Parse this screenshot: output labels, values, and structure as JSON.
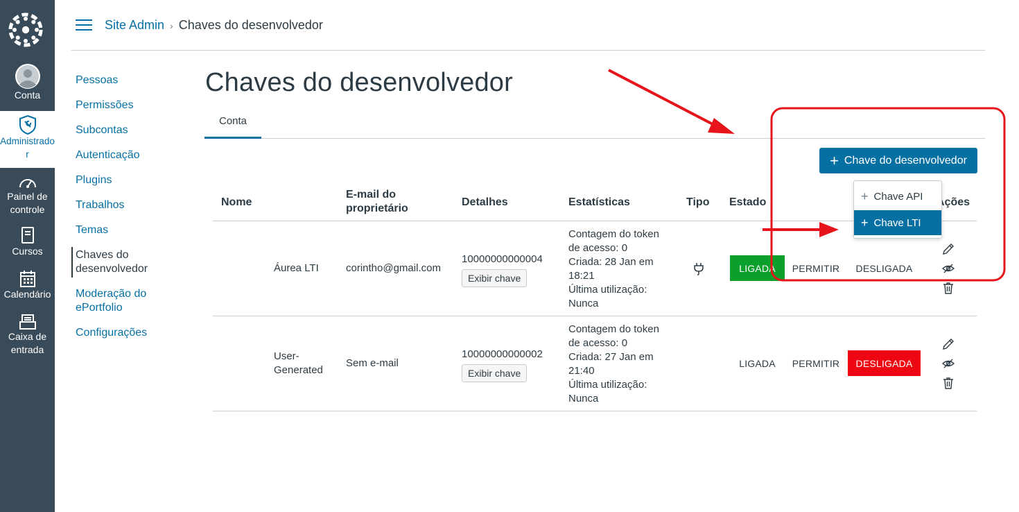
{
  "global_nav": {
    "items": [
      {
        "label": "Conta",
        "icon": "user-avatar-icon"
      },
      {
        "label": "Administrador",
        "icon": "admin-shield-icon"
      },
      {
        "label_lines": [
          "Painel de",
          "controle"
        ],
        "icon": "dashboard-icon"
      },
      {
        "label": "Cursos",
        "icon": "courses-icon"
      },
      {
        "label": "Calendário",
        "icon": "calendar-icon"
      },
      {
        "label_lines": [
          "Caixa de",
          "entrada"
        ],
        "icon": "inbox-icon"
      }
    ],
    "admin_label_lines": [
      "Administrado",
      "r"
    ]
  },
  "header": {
    "breadcrumb_root": "Site Admin",
    "breadcrumb_current": "Chaves do desenvolvedor"
  },
  "subnav": {
    "items": [
      "Pessoas",
      "Permissões",
      "Subcontas",
      "Autenticação",
      "Plugins",
      "Trabalhos",
      "Temas"
    ],
    "active_lines": [
      "Chaves do",
      "desenvolvedor"
    ],
    "after_lines": [
      "Moderação do",
      "ePortfolio"
    ],
    "last": "Configurações"
  },
  "main": {
    "title": "Chaves do desenvolvedor",
    "tab": "Conta",
    "add_button": "Chave do desenvolvedor",
    "dropdown": {
      "items": [
        "Chave API",
        "Chave LTI"
      ],
      "highlighted": "Chave LTI"
    }
  },
  "table": {
    "headers": {
      "name": "Nome",
      "owner_lines": [
        "E-mail do",
        "proprietário"
      ],
      "details": "Detalhes",
      "stats": "Estatísticas",
      "type": "Tipo",
      "state": "Estado",
      "actions": "Ações"
    },
    "rows": [
      {
        "name_lines": [
          "Áurea LTI"
        ],
        "email": "corintho@gmail.com",
        "id": "10000000000004",
        "show_key": "Exibir chave",
        "stats_lines": [
          "Contagem do token",
          "de acesso: 0",
          "Criada: 28 Jan em",
          "18:21",
          "Última utilização:",
          "Nunca"
        ],
        "type_icon": "plug-icon",
        "states": [
          "LIGADA",
          "PERMITIR",
          "DESLIGADA"
        ],
        "active_state": "LIGADA"
      },
      {
        "name_lines": [
          "User-",
          "Generated"
        ],
        "email": "Sem e-mail",
        "id": "10000000000002",
        "show_key": "Exibir chave",
        "stats_lines": [
          "Contagem do token",
          "de acesso: 0",
          "Criada: 27 Jan em",
          "21:40",
          "Última utilização:",
          "Nunca"
        ],
        "type_icon": "",
        "states": [
          "LIGADA",
          "PERMITIR",
          "DESLIGADA"
        ],
        "active_state": "DESLIGADA"
      }
    ]
  },
  "colors": {
    "brand": "#0770a3",
    "nav_bg": "#394b58",
    "on": "#0b9f2b",
    "off": "#ee0612",
    "annotation": "#e8141b"
  }
}
